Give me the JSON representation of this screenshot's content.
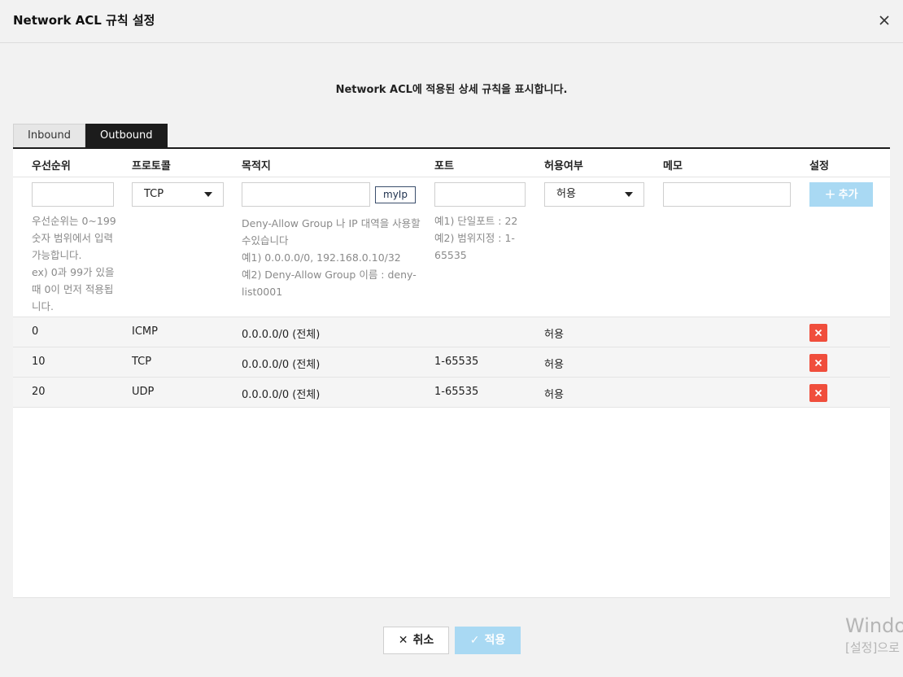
{
  "modal": {
    "title": "Network ACL 규칙 설정",
    "description": "Network ACL에 적용된 상세 규칙을 표시합니다."
  },
  "tabs": [
    {
      "label": "Inbound",
      "active": false
    },
    {
      "label": "Outbound",
      "active": true
    }
  ],
  "table": {
    "headers": [
      "우선순위",
      "프로토콜",
      "목적지",
      "포트",
      "허용여부",
      "메모",
      "설정"
    ],
    "new_rule": {
      "priority_value": "",
      "protocol_value": "TCP",
      "destination_value": "",
      "myip_label": "myIp",
      "port_value": "",
      "allow_value": "허용",
      "memo_value": "",
      "add_label": "추가",
      "priority_hint": [
        "우선순위는 0~199",
        "숫자 범위에서 입력",
        "가능합니다.",
        "ex) 0과 99가 있을",
        "때 0이 먼저 적용됩",
        "니다."
      ],
      "destination_hint": [
        "Deny-Allow Group 나 IP 대역을 사용할",
        "수있습니다",
        "예1) 0.0.0.0/0, 192.168.0.10/32",
        "예2) Deny-Allow Group 이름 : deny-",
        "list0001"
      ],
      "port_hint": [
        "예1) 단일포트 : 22",
        "예2) 범위지정 : 1-",
        "65535"
      ]
    },
    "rows": [
      {
        "priority": "0",
        "protocol": "ICMP",
        "destination": "0.0.0.0/0 (전체)",
        "port": "",
        "allow": "허용",
        "memo": ""
      },
      {
        "priority": "10",
        "protocol": "TCP",
        "destination": "0.0.0.0/0 (전체)",
        "port": "1-65535",
        "allow": "허용",
        "memo": ""
      },
      {
        "priority": "20",
        "protocol": "UDP",
        "destination": "0.0.0.0/0 (전체)",
        "port": "1-65535",
        "allow": "허용",
        "memo": ""
      }
    ]
  },
  "footer": {
    "cancel_label": "취소",
    "apply_label": "적용"
  },
  "watermark": {
    "line1": "Windo",
    "line2": "[설정]으로"
  },
  "colors": {
    "accent": "#a9d9f3",
    "delete": "#f04e3c",
    "tab_active": "#1c1c1c"
  }
}
